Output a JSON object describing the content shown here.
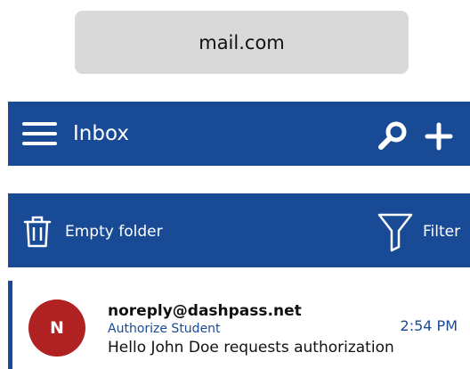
{
  "colors": {
    "brand_blue": "#194a96",
    "avatar_red": "#b02222",
    "url_bar_bg": "#d9d9d9"
  },
  "browser": {
    "url": "mail.com"
  },
  "header": {
    "title": "Inbox",
    "menu_icon": "hamburger-menu-icon",
    "search_icon": "search-icon",
    "compose_icon": "plus-icon"
  },
  "actions": {
    "empty_folder_label": "Empty folder",
    "empty_folder_icon": "trash-icon",
    "filter_label": "Filter",
    "filter_icon": "funnel-icon"
  },
  "messages": [
    {
      "avatar_letter": "N",
      "sender": "noreply@dashpass.net",
      "subject": "Authorize Student",
      "preview": "Hello John Doe requests authorization",
      "time": "2:54 PM"
    }
  ]
}
